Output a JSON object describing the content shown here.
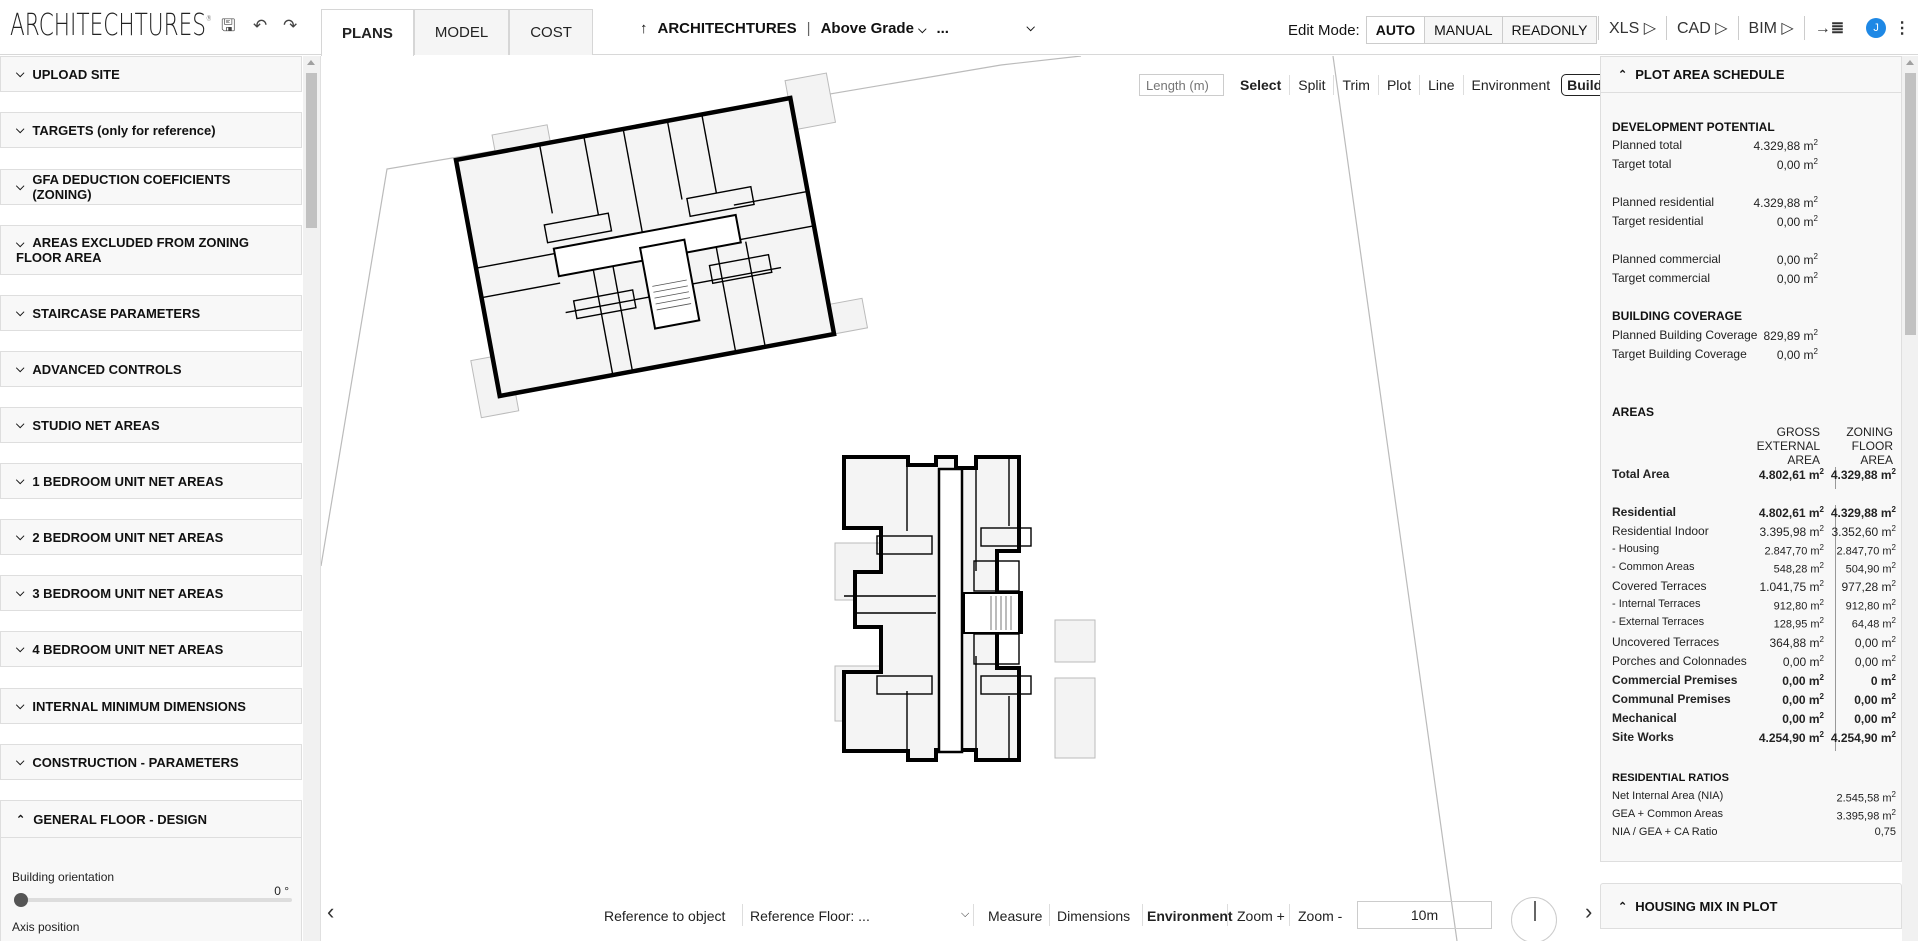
{
  "header": {
    "logo": "ARCHITECHTURES",
    "logo_mark": "®",
    "icons": {
      "save": "save-icon",
      "undo": "undo-icon",
      "redo": "redo-icon"
    },
    "tabs": [
      {
        "label": "PLANS",
        "active": true
      },
      {
        "label": "MODEL",
        "active": false
      },
      {
        "label": "COST",
        "active": false
      }
    ],
    "breadcrumb": {
      "up_icon": "↑",
      "project": "ARCHITECHTURES",
      "separator": "|",
      "level": "Above Grade",
      "floor": "...",
      "dropdown_icon": "chevron-down-icon"
    },
    "edit_mode": {
      "label": "Edit Mode:",
      "options": [
        "AUTO",
        "MANUAL",
        "READONLY"
      ],
      "selected": "AUTO"
    },
    "exports": [
      {
        "label": "XLS ▷"
      },
      {
        "label": "CAD ▷"
      },
      {
        "label": "BIM ▷"
      },
      {
        "label": "→≣"
      }
    ],
    "user_initial": "J",
    "menu_icon": "⋮",
    "accent": "#1e88e5"
  },
  "left_panel": {
    "sections": [
      {
        "label": "UPLOAD SITE",
        "expanded": false
      },
      {
        "label": "TARGETS (only for reference)",
        "expanded": false
      },
      {
        "label": "GFA DEDUCTION COEFICIENTS (ZONING)",
        "expanded": false
      },
      {
        "label": "AREAS EXCLUDED FROM ZONING FLOOR AREA",
        "expanded": false
      },
      {
        "label": "STAIRCASE PARAMETERS",
        "expanded": false
      },
      {
        "label": "ADVANCED CONTROLS",
        "expanded": false
      },
      {
        "label": "STUDIO NET AREAS",
        "expanded": false
      },
      {
        "label": "1 BEDROOM UNIT NET AREAS",
        "expanded": false
      },
      {
        "label": "2 BEDROOM UNIT NET AREAS",
        "expanded": false
      },
      {
        "label": "3 BEDROOM UNIT NET AREAS",
        "expanded": false
      },
      {
        "label": "4 BEDROOM UNIT NET AREAS",
        "expanded": false
      },
      {
        "label": "INTERNAL MINIMUM DIMENSIONS",
        "expanded": false
      },
      {
        "label": "CONSTRUCTION - PARAMETERS",
        "expanded": false
      },
      {
        "label": "GENERAL FLOOR - DESIGN",
        "expanded": true
      }
    ],
    "general_floor": {
      "building_orientation_label": "Building orientation",
      "building_orientation_value": "0 °",
      "building_orientation_fraction": 0,
      "axis_position_label": "Axis position"
    }
  },
  "canvas": {
    "length_placeholder": "Length (m)",
    "tools": [
      "Select",
      "Split",
      "Trim",
      "Plot",
      "Line",
      "Environment",
      "Building"
    ],
    "active_tool": "Building",
    "bottom": {
      "reference_to_object": "Reference to object",
      "reference_floor": "Reference Floor:  ...",
      "measure": "Measure",
      "dimensions": "Dimensions",
      "environment": "Environment",
      "zoom_in": "Zoom +",
      "zoom_out": "Zoom -",
      "scale": "10m"
    }
  },
  "right_panel": {
    "title": "PLOT AREA SCHEDULE",
    "development_potential": {
      "title": "DEVELOPMENT POTENTIAL",
      "rows": [
        {
          "label": "Planned total",
          "value": "4.329,88 m"
        },
        {
          "label": "Target total",
          "value": "0,00 m"
        },
        {
          "label": "Planned residential",
          "value": "4.329,88 m"
        },
        {
          "label": "Target residential",
          "value": "0,00 m"
        },
        {
          "label": "Planned commercial",
          "value": "0,00 m"
        },
        {
          "label": "Target commercial",
          "value": "0,00 m"
        }
      ]
    },
    "building_coverage": {
      "title": "BUILDING COVERAGE",
      "rows": [
        {
          "label": "Planned Building Coverage",
          "value": "829,89 m"
        },
        {
          "label": "Target Building Coverage",
          "value": "0,00 m"
        }
      ]
    },
    "areas": {
      "title": "AREAS",
      "col_gea": [
        "GROSS",
        "EXTERNAL",
        "AREA"
      ],
      "col_zfa": [
        "ZONING",
        "FLOOR",
        "AREA"
      ],
      "rows": [
        {
          "label": "Total Area",
          "gea": "4.802,61 m",
          "zfa": "4.329,88 m",
          "bold": true
        },
        {
          "label": "Residential",
          "gea": "4.802,61 m",
          "zfa": "4.329,88 m",
          "bold": true
        },
        {
          "label": "Residential Indoor",
          "gea": "3.395,98 m",
          "zfa": "3.352,60 m",
          "bold": false
        },
        {
          "label": "- Housing",
          "gea": "2.847,70 m",
          "zfa": "2.847,70 m",
          "bold": false,
          "small": true
        },
        {
          "label": "- Common Areas",
          "gea": "548,28 m",
          "zfa": "504,90 m",
          "bold": false,
          "small": true
        },
        {
          "label": "Covered Terraces",
          "gea": "1.041,75 m",
          "zfa": "977,28 m",
          "bold": false
        },
        {
          "label": "- Internal Terraces",
          "gea": "912,80 m",
          "zfa": "912,80 m",
          "bold": false,
          "small": true
        },
        {
          "label": "- External Terraces",
          "gea": "128,95 m",
          "zfa": "64,48 m",
          "bold": false,
          "small": true
        },
        {
          "label": "Uncovered Terraces",
          "gea": "364,88 m",
          "zfa": "0,00 m",
          "bold": false
        },
        {
          "label": "Porches and Colonnades",
          "gea": "0,00 m",
          "zfa": "0,00 m",
          "bold": false
        },
        {
          "label": "Commercial Premises",
          "gea": "0,00 m",
          "zfa": "0 m",
          "bold": true
        },
        {
          "label": "Communal Premises",
          "gea": "0,00 m",
          "zfa": "0,00 m",
          "bold": true
        },
        {
          "label": "Mechanical",
          "gea": "0,00 m",
          "zfa": "0,00 m",
          "bold": true
        },
        {
          "label": "Site Works",
          "gea": "4.254,90 m",
          "zfa": "4.254,90 m",
          "bold": true
        }
      ]
    },
    "residential_ratios": {
      "title": "RESIDENTIAL RATIOS",
      "rows": [
        {
          "label": "Net Internal Area (NIA)",
          "value": "2.545,58 m",
          "unit_sup": true
        },
        {
          "label": "GEA + Common Areas",
          "value": "3.395,98 m",
          "unit_sup": true
        },
        {
          "label": "NIA / GEA + CA Ratio",
          "value": "0,75",
          "unit_sup": false
        }
      ]
    },
    "housing_mix_title": "HOUSING MIX IN PLOT",
    "unit_sup": "2"
  }
}
